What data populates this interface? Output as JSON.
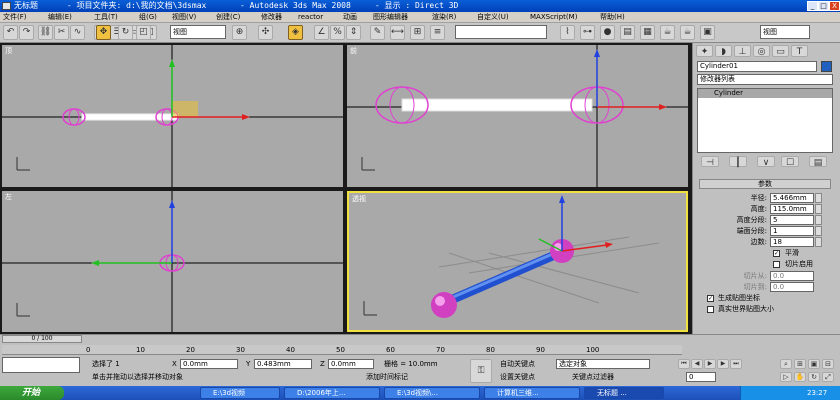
{
  "window": {
    "title": "无标题      - 项目文件夹: d:\\我的文档\\3dsmax       - Autodesk 3ds Max 2008     - 显示 : Direct 3D",
    "minimize": "_",
    "maximize": "□",
    "close": "X"
  },
  "menu": [
    "文件(F)",
    "编辑(E)",
    "工具(T)",
    "组(G)",
    "视图(V)",
    "创建(C)",
    "修改器",
    "reactor",
    "动画",
    "图形编辑器",
    "渲染(R)",
    "自定义(U)",
    "MAXScript(M)",
    "帮助(H)"
  ],
  "toolbar": {
    "ref_coord": "视图",
    "named_selection": "",
    "view_select": "视图"
  },
  "viewports": {
    "top": "顶",
    "front": "前",
    "left": "左",
    "persp": "透视"
  },
  "command_panel": {
    "object_name": "Cylinder01",
    "modifier_list": "修改器列表",
    "stack_item": "Cylinder",
    "rollout_title": "参数",
    "params": [
      {
        "label": "半径:",
        "value": "5.466mm"
      },
      {
        "label": "高度:",
        "value": "115.0mm"
      },
      {
        "label": "高度分段:",
        "value": "5"
      },
      {
        "label": "端面分段:",
        "value": "1"
      },
      {
        "label": "边数:",
        "value": "18"
      }
    ],
    "smooth_label": "平滑",
    "slice_on_label": "切片启用",
    "slice_from_label": "切片从:",
    "slice_from_value": "0.0",
    "slice_to_label": "切片到:",
    "slice_to_value": "0.0",
    "gen_mapping_label": "生成贴图坐标",
    "real_world_label": "真实世界贴图大小"
  },
  "timeline": {
    "frame_display": "0 / 100",
    "ticks": [
      "0",
      "10",
      "20",
      "30",
      "40",
      "50",
      "60",
      "70",
      "80",
      "90",
      "100"
    ]
  },
  "status": {
    "selection": "选择了 1",
    "x_label": "X",
    "x_value": "0.0mm",
    "y_label": "Y",
    "y_value": "0.483mm",
    "z_label": "Z",
    "z_value": "0.0mm",
    "grid": "栅格 = 10.0mm",
    "prompt": "单击并拖动以选择并移动对象",
    "add_time_tag": "添加时间标记",
    "auto_key": "自动关键点",
    "set_key": "设置关键点",
    "selected_obj": "选定对象",
    "key_filters": "关键点过滤器",
    "frame_field": "0"
  },
  "taskbar": {
    "start": "开始",
    "tasks": [
      "E:\\3d视频",
      "D:\\2006年上...",
      "E:\\3d视频\\...",
      "计算机三维...",
      "无标题 ..."
    ],
    "clock": "23:27"
  },
  "colors": {
    "accent": "#f0c040",
    "sphere": "#e060d0",
    "cylinder": "#3060e0"
  }
}
